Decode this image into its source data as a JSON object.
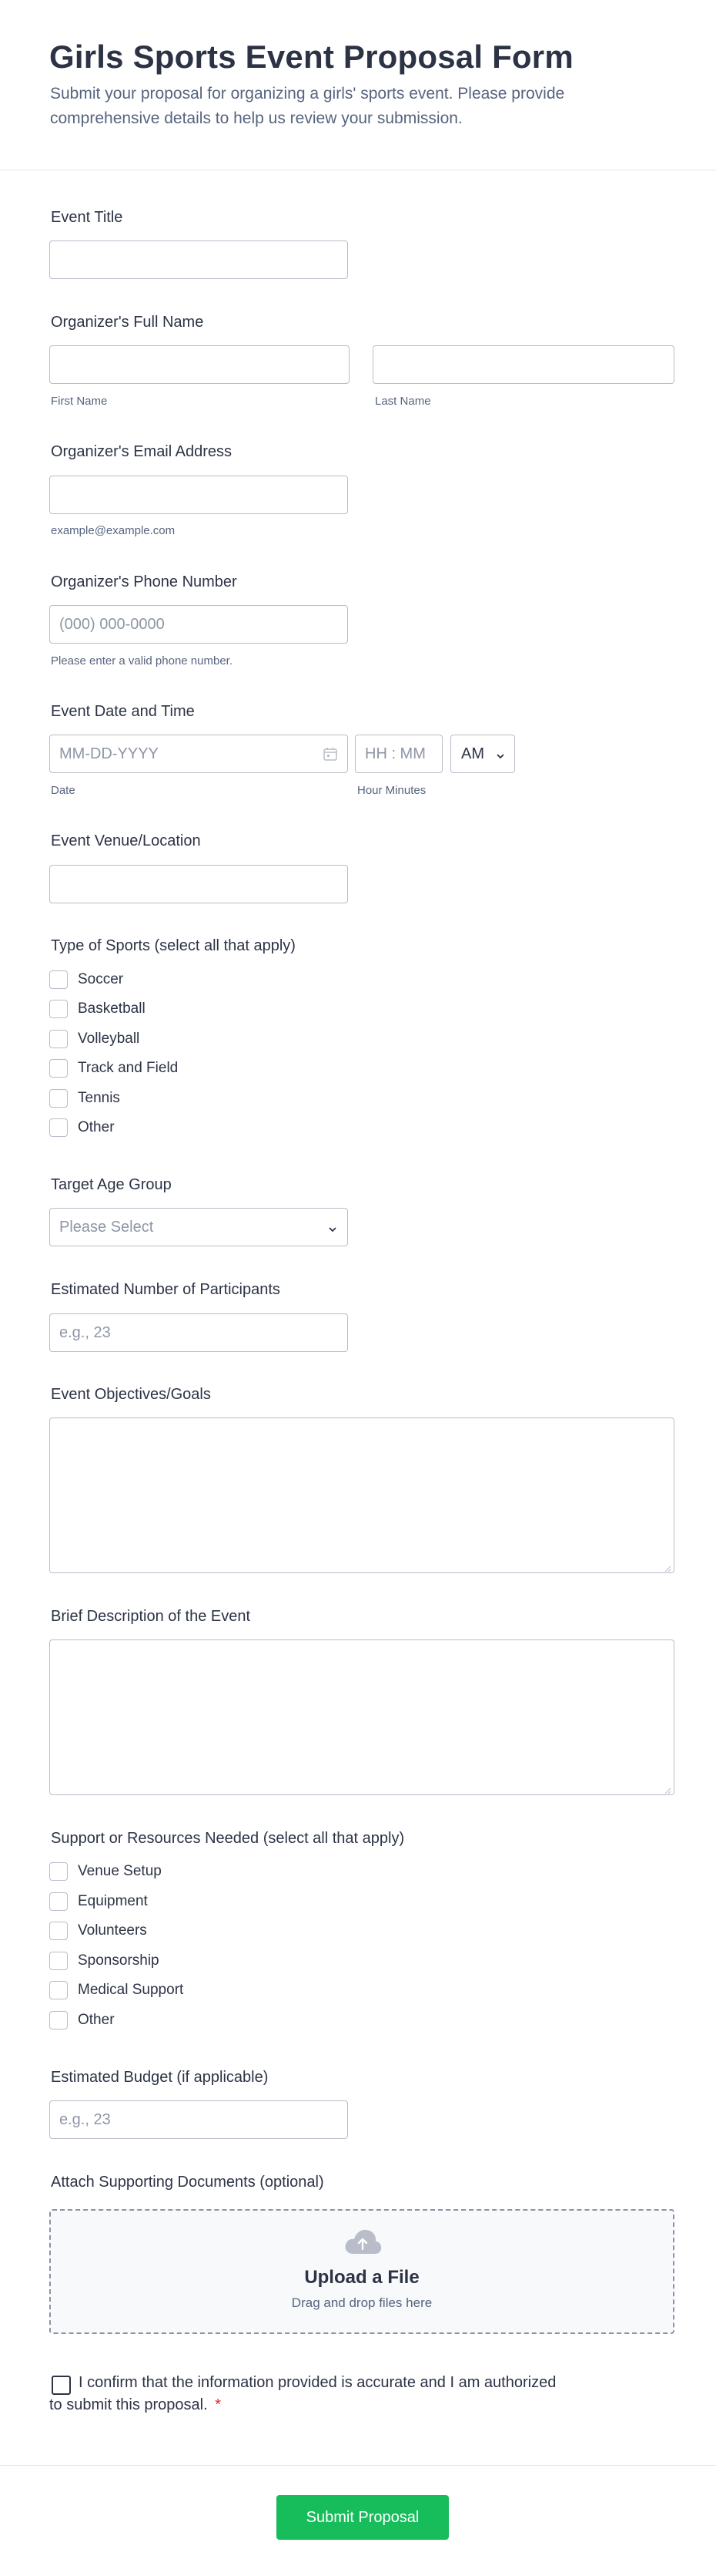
{
  "header": {
    "title": "Girls Sports Event Proposal Form",
    "subtitle": "Submit your proposal for organizing a girls' sports event. Please provide comprehensive details to help us review your submission."
  },
  "fields": {
    "event_title": {
      "label": "Event Title",
      "value": ""
    },
    "organizer_name": {
      "label": "Organizer's Full Name",
      "first_sublabel": "First Name",
      "last_sublabel": "Last Name"
    },
    "email": {
      "label": "Organizer's Email Address",
      "sublabel": "example@example.com"
    },
    "phone": {
      "label": "Organizer's Phone Number",
      "placeholder": "(000) 000-0000",
      "sublabel": "Please enter a valid phone number."
    },
    "datetime": {
      "label": "Event Date and Time",
      "date_placeholder": "MM-DD-YYYY",
      "time_placeholder": "HH : MM",
      "ampm_value": "AM",
      "date_sublabel": "Date",
      "time_sublabel": "Hour Minutes"
    },
    "venue": {
      "label": "Event Venue/Location"
    },
    "sports": {
      "label": "Type of Sports (select all that apply)",
      "options": [
        "Soccer",
        "Basketball",
        "Volleyball",
        "Track and Field",
        "Tennis",
        "Other"
      ]
    },
    "age_group": {
      "label": "Target Age Group",
      "placeholder": "Please Select"
    },
    "participants": {
      "label": "Estimated Number of Participants",
      "placeholder": "e.g., 23"
    },
    "objectives": {
      "label": "Event Objectives/Goals"
    },
    "description": {
      "label": "Brief Description of the Event"
    },
    "resources": {
      "label": "Support or Resources Needed (select all that apply)",
      "options": [
        "Venue Setup",
        "Equipment",
        "Volunteers",
        "Sponsorship",
        "Medical Support",
        "Other"
      ]
    },
    "budget": {
      "label": "Estimated Budget (if applicable)",
      "placeholder": "e.g., 23"
    },
    "documents": {
      "label": "Attach Supporting Documents (optional)",
      "upload_title": "Upload a File",
      "upload_sub": "Drag and drop files here"
    },
    "confirm": {
      "line1": "I confirm that the information provided is accurate and I am authorized",
      "line2": "to submit this proposal.",
      "required_mark": "*"
    }
  },
  "submit_label": "Submit Proposal",
  "colors": {
    "accent": "#18bd5b",
    "required": "#e0262b",
    "text": "#2c3345",
    "muted": "#57647e",
    "border": "#b8bdc9"
  },
  "icons": [
    "calendar-icon",
    "chevron-down-icon",
    "cloud-upload-icon",
    "resize-grip-icon"
  ]
}
